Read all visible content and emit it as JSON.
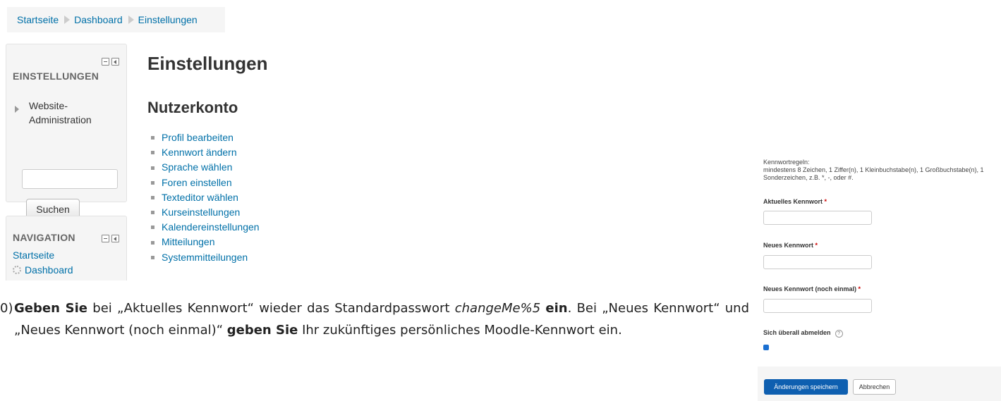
{
  "breadcrumb": {
    "items": [
      "Startseite",
      "Dashboard",
      "Einstellungen"
    ]
  },
  "settings_block": {
    "title": "EINSTELLUNGEN",
    "admin_item_line1": "Website-",
    "admin_item_line2": "Administration",
    "search_value": "",
    "search_button": "Suchen"
  },
  "nav_block": {
    "title": "NAVIGATION",
    "links": [
      "Startseite",
      "Dashboard"
    ]
  },
  "main": {
    "title": "Einstellungen",
    "section_title": "Nutzerkonto",
    "links": [
      "Profil bearbeiten",
      "Kennwort ändern",
      "Sprache wählen",
      "Foren einstellen",
      "Texteditor wählen",
      "Kurseinstellungen",
      "Kalendereinstellungen",
      "Mitteilungen",
      "Systemmitteilungen"
    ]
  },
  "instruction": {
    "number": "0)",
    "p1": "Geben Sie",
    "p2": " bei „Aktuelles Kennwort“ wieder das Standardpasswort ",
    "p3": "changeMe%5",
    "p4": " ",
    "p5": "ein",
    "p6": ". Bei „Neues Kennwort“ und „Neues Kennwort (noch einmal)“ ",
    "p7": "geben Sie",
    "p8": " Ihr zukünftiges persönliches Moodle-Kennwort ein."
  },
  "password_form": {
    "rules_label": "Kennwortregeln:",
    "rules_line1": "mindestens 8 Zeichen, 1 Ziffer(n), 1 Kleinbuchstabe(n), 1 Großbuchstabe(n), 1",
    "rules_line2": "Sonderzeichen, z.B. *, -, oder #.",
    "current_label": "Aktuelles Kennwort",
    "new_label": "Neues Kennwort",
    "repeat_label": "Neues Kennwort (noch einmal)",
    "required_mark": "*",
    "logout_label": "Sich überall abmelden",
    "help_glyph": "?",
    "logout_checked": true,
    "save_button": "Änderungen speichern",
    "cancel_button": "Abbrechen"
  }
}
